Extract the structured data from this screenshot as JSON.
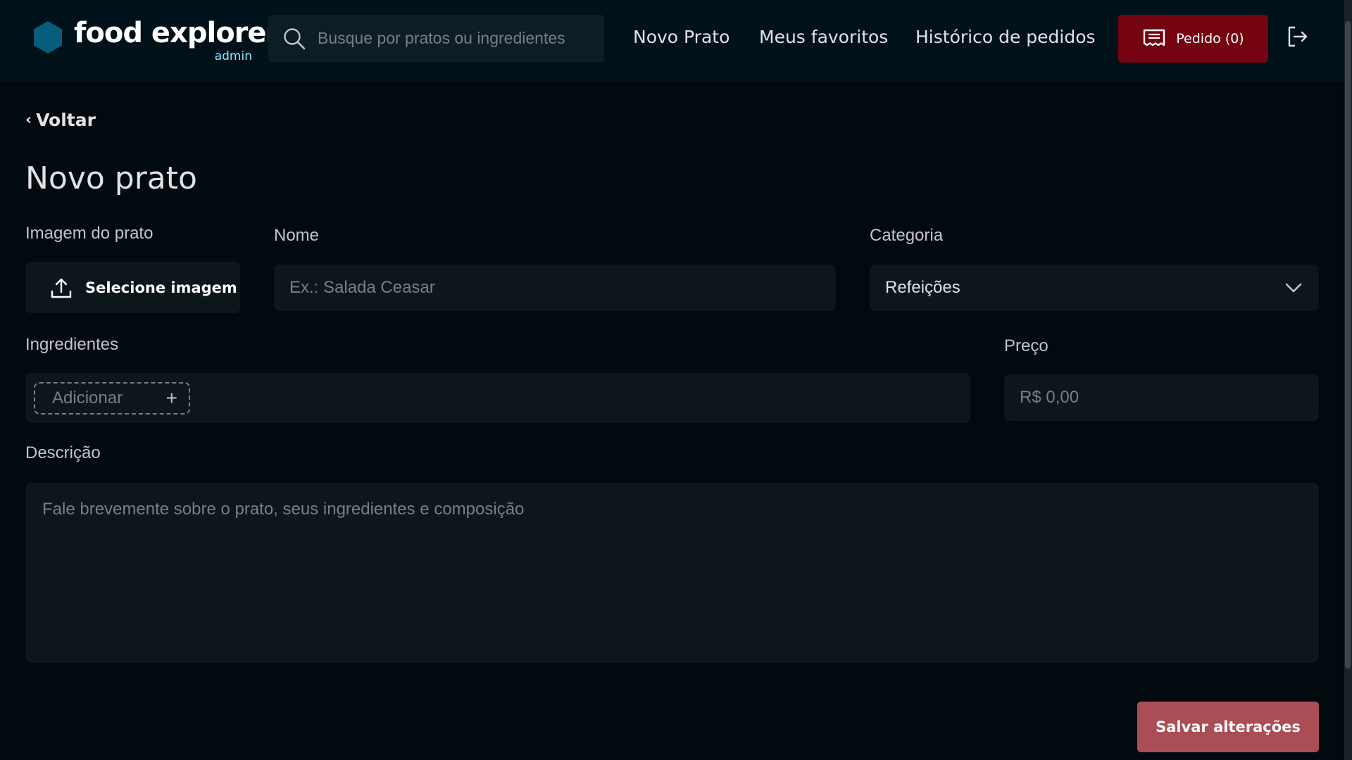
{
  "header": {
    "brand_name": "food explorer",
    "brand_role": "admin",
    "search_placeholder": "Busque por pratos ou ingredientes",
    "nav": {
      "new_dish": "Novo Prato",
      "favorites": "Meus favoritos",
      "orders_history": "Histórico de pedidos"
    },
    "order_button": "Pedido (0)",
    "icons": {
      "logo": "hexagon-logo-icon",
      "search": "search-icon",
      "order": "receipt-icon",
      "logout": "logout-icon"
    }
  },
  "colors": {
    "background": "#000a0f",
    "header": "#00111a",
    "input_bg": "#0d161b",
    "accent_red": "#750310",
    "save_button": "#ab4d55",
    "brand_hex": "#065e7c",
    "brand_role": "#82f3ff"
  },
  "main": {
    "back_label": "Voltar",
    "title": "Novo prato",
    "image_label": "Imagem do prato",
    "upload_button": "Selecione imagem",
    "name_label": "Nome",
    "name_placeholder": "Ex.: Salada Ceasar",
    "category_label": "Categoria",
    "category_value": "Refeições",
    "ingredients_label": "Ingredientes",
    "add_ingredient": "Adicionar",
    "add_symbol": "+",
    "price_label": "Preço",
    "price_placeholder": "R$ 0,00",
    "description_label": "Descrição",
    "description_placeholder": "Fale brevemente sobre o prato, seus ingredientes e composição",
    "save_button": "Salvar alterações"
  }
}
